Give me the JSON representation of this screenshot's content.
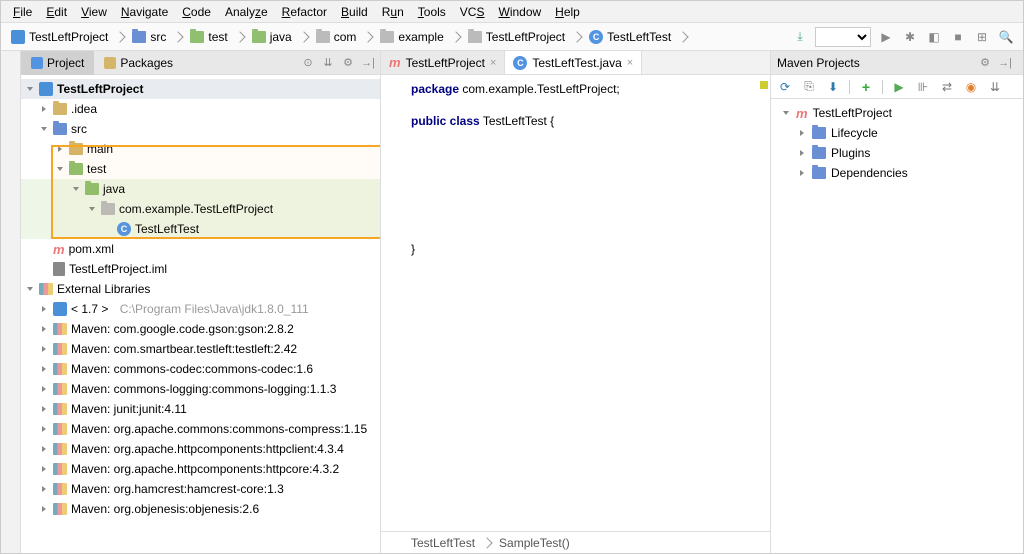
{
  "menu": {
    "file": "File",
    "edit": "Edit",
    "view": "View",
    "navigate": "Navigate",
    "code": "Code",
    "analyze": "Analyze",
    "refactor": "Refactor",
    "build": "Build",
    "run": "Run",
    "tools": "Tools",
    "vcs": "VCS",
    "window": "Window",
    "help": "Help"
  },
  "breadcrumb": [
    "TestLeftProject",
    "src",
    "test",
    "java",
    "com",
    "example",
    "TestLeftProject",
    "TestLeftTest"
  ],
  "project_tabs": {
    "project": "Project",
    "packages": "Packages"
  },
  "tree": {
    "root": "TestLeftProject",
    "idea": ".idea",
    "src": "src",
    "main": "main",
    "test": "test",
    "java": "java",
    "pkg": "com.example.TestLeftProject",
    "cls": "TestLeftTest",
    "pom": "pom.xml",
    "iml": "TestLeftProject.iml",
    "ext": "External Libraries",
    "jdk": "< 1.7 >",
    "jdkpath": "C:\\Program Files\\Java\\jdk1.8.0_111",
    "libs": [
      "Maven: com.google.code.gson:gson:2.8.2",
      "Maven: com.smartbear.testleft:testleft:2.42",
      "Maven: commons-codec:commons-codec:1.6",
      "Maven: commons-logging:commons-logging:1.1.3",
      "Maven: junit:junit:4.11",
      "Maven: org.apache.commons:commons-compress:1.15",
      "Maven: org.apache.httpcomponents:httpclient:4.3.4",
      "Maven: org.apache.httpcomponents:httpcore:4.3.2",
      "Maven: org.hamcrest:hamcrest-core:1.3",
      "Maven: org.objenesis:objenesis:2.6"
    ]
  },
  "editor": {
    "tab1": "TestLeftProject",
    "tab2": "TestLeftTest.java",
    "line1a": "package",
    "line1b": " com.example.TestLeftProject;",
    "line3a": "public class",
    "line3b": " TestLeftTest {",
    "line_end": "}",
    "bc1": "TestLeftTest",
    "bc2": "SampleTest()"
  },
  "maven": {
    "title": "Maven Projects",
    "root": "TestLeftProject",
    "lifecycle": "Lifecycle",
    "plugins": "Plugins",
    "deps": "Dependencies"
  }
}
